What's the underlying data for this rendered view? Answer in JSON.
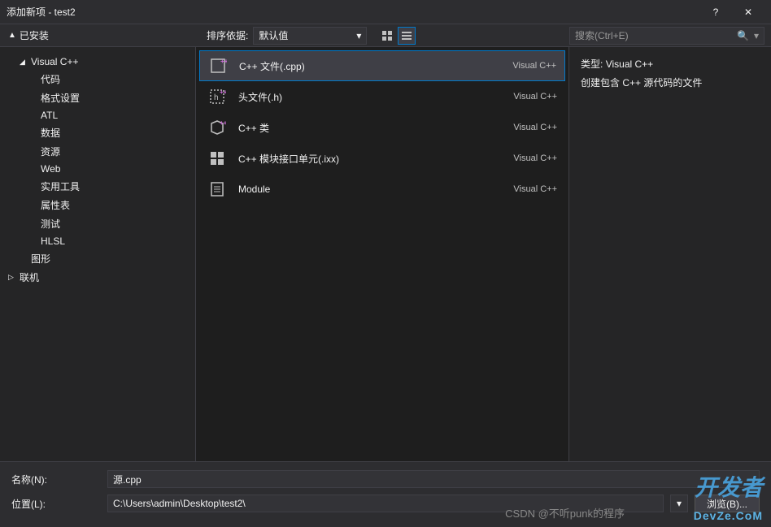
{
  "window": {
    "title": "添加新项 - test2",
    "help": "?",
    "close": "✕"
  },
  "toolbar": {
    "installed_label": "已安装",
    "sort_label": "排序依据:",
    "sort_value": "默认值",
    "search_placeholder": "搜索(Ctrl+E)"
  },
  "sidebar": {
    "root": "Visual C++",
    "items": [
      "代码",
      "格式设置",
      "ATL",
      "数据",
      "资源",
      "Web",
      "实用工具",
      "属性表",
      "测试",
      "HLSL"
    ],
    "graphics": "图形",
    "online": "联机"
  },
  "templates": [
    {
      "name": "C++ 文件(.cpp)",
      "lang": "Visual C++",
      "selected": true,
      "icon": "cpp"
    },
    {
      "name": "头文件(.h)",
      "lang": "Visual C++",
      "selected": false,
      "icon": "h"
    },
    {
      "name": "C++ 类",
      "lang": "Visual C++",
      "selected": false,
      "icon": "class"
    },
    {
      "name": "C++ 模块接口单元(.ixx)",
      "lang": "Visual C++",
      "selected": false,
      "icon": "module"
    },
    {
      "name": "Module",
      "lang": "Visual C++",
      "selected": false,
      "icon": "doc"
    }
  ],
  "details": {
    "type_label": "类型:",
    "type_value": "Visual C++",
    "description": "创建包含 C++ 源代码的文件"
  },
  "form": {
    "name_label": "名称(N):",
    "name_value": "源.cpp",
    "location_label": "位置(L):",
    "location_value": "C:\\Users\\admin\\Desktop\\test2\\",
    "browse": "浏览(B)..."
  },
  "watermarks": {
    "w1": "开发者",
    "w2": "CSDN @不听punk的程序",
    "w3": "DevZe.CoM"
  }
}
